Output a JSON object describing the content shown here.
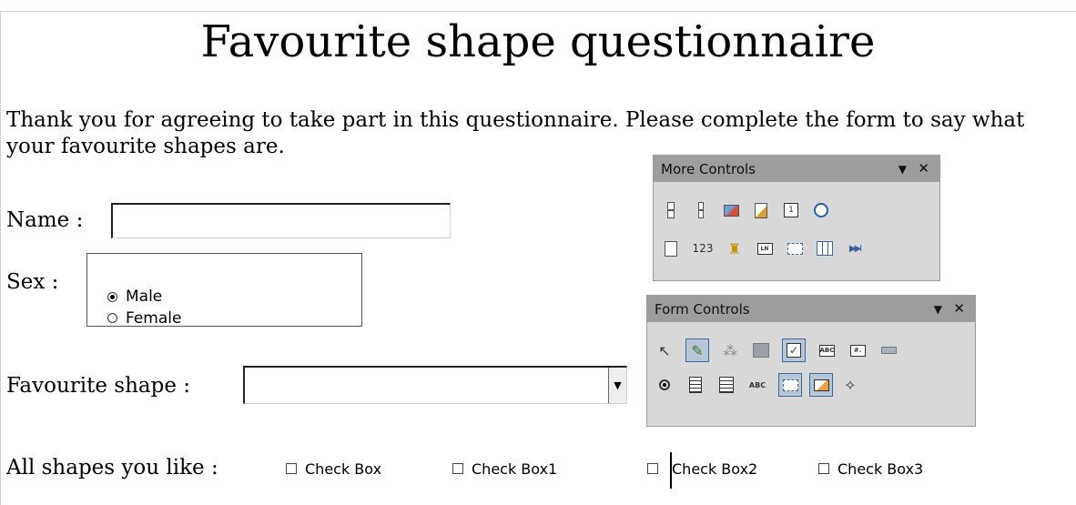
{
  "document": {
    "title": "Favourite shape questionnaire",
    "intro": "Thank you for agreeing to take part in this questionnaire.  Please complete the form to say what your favourite shapes are."
  },
  "form": {
    "name_label": "Name :",
    "name_value": "",
    "sex_label": "Sex :",
    "sex_options": [
      {
        "label": "Male",
        "selected": true
      },
      {
        "label": "Female",
        "selected": false
      }
    ],
    "shape_label": "Favourite shape :",
    "shape_value": "",
    "all_shapes_label": "All shapes you like :",
    "checkboxes": [
      "Check Box",
      "Check Box1",
      "Check Box2",
      "Check Box3"
    ]
  },
  "more_controls": {
    "title": "More Controls",
    "menu_glyph": "▼",
    "close_glyph": "✕",
    "numeric_field_text": "123",
    "row1_icons": [
      "numeric-spin-icon",
      "spin-button-icon",
      "image-control-icon",
      "file-selection-icon",
      "date-field-icon",
      "time-field-icon"
    ],
    "row2_icons": [
      "select-cursor-icon",
      "numeric-field-icon",
      "currency-field-icon",
      "formatted-field-icon",
      "grouped-list-icon",
      "table-control-icon",
      "navigation-bar-icon"
    ]
  },
  "form_controls": {
    "title": "Form Controls",
    "menu_glyph": "▼",
    "close_glyph": "✕",
    "text_box_label": "ABC",
    "formatted_label": "#.",
    "label_field_text": "ABC",
    "row1_icons": [
      "select-icon",
      "design-mode-icon",
      "form-navigator-icon",
      "form-properties-icon",
      "check-box-icon",
      "text-box-icon",
      "formatted-field-icon",
      "push-button-icon"
    ],
    "row2_icons": [
      "option-button-icon",
      "list-box-icon",
      "combo-box-icon",
      "label-field-icon",
      "more-controls-icon",
      "form-design-icon",
      "wizards-icon"
    ],
    "selected": [
      "design-mode-icon",
      "check-box-icon",
      "more-controls-icon",
      "form-design-icon"
    ]
  }
}
